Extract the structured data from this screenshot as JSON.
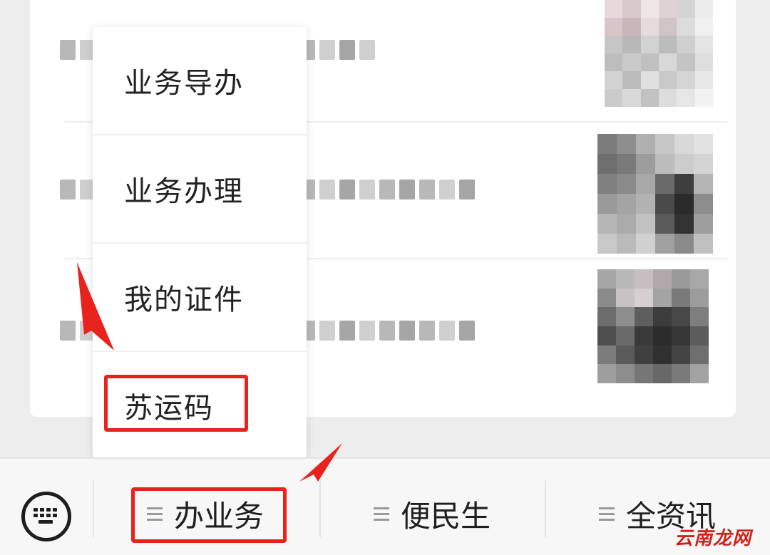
{
  "popup_menu": {
    "items": [
      {
        "label": "业务导办"
      },
      {
        "label": "业务办理"
      },
      {
        "label": "我的证件"
      },
      {
        "label": "苏运码"
      }
    ]
  },
  "bottom_bar": {
    "keyboard_icon": "keyboard-icon",
    "tabs": [
      {
        "label": "办业务",
        "icon": "menu-lines-icon"
      },
      {
        "label": "便民生",
        "icon": "menu-lines-icon"
      },
      {
        "label": "全资讯",
        "icon": "menu-lines-icon"
      }
    ]
  },
  "annotations": {
    "highlight_color": "#e8231d",
    "arrow_color": "#e8231d"
  },
  "watermark": {
    "text": "云南龙网"
  }
}
